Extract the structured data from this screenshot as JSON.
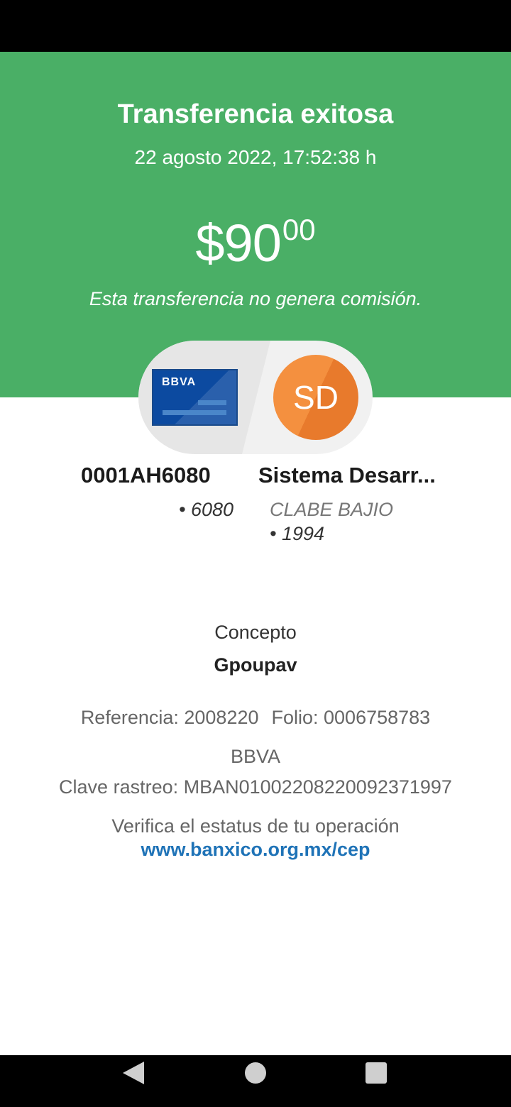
{
  "colors": {
    "header_green": "#4aaf66",
    "link_blue": "#1f73b7",
    "avatar_orange": "#f4903f"
  },
  "header": {
    "title": "Transferencia exitosa",
    "datetime": "22 agosto 2022, 17:52:38 h",
    "amount_main": "$90",
    "amount_cents": "00",
    "commission_note": "Esta transferencia no genera comisión."
  },
  "origin": {
    "bank_logo_text": "BBVA",
    "account_name": "0001AH6080",
    "account_suffix": "• 6080",
    "icon": "bank-card-icon"
  },
  "destination": {
    "avatar_initials": "SD",
    "account_name": "Sistema Desarr...",
    "account_type": "CLABE BAJIO",
    "account_suffix": "• 1994"
  },
  "details": {
    "concept_label": "Concepto",
    "concept_value": "Gpoupav",
    "reference": "Referencia: 2008220",
    "folio": "Folio: 0006758783",
    "bank": "BBVA",
    "tracking_key": "Clave rastreo: MBAN01002208220092371997",
    "verify_text": "Verifica el estatus de tu operación",
    "verify_link": "www.banxico.org.mx/cep"
  },
  "navigation": {
    "back_icon": "triangle-back-icon",
    "home_icon": "circle-home-icon",
    "recent_icon": "square-recents-icon"
  }
}
